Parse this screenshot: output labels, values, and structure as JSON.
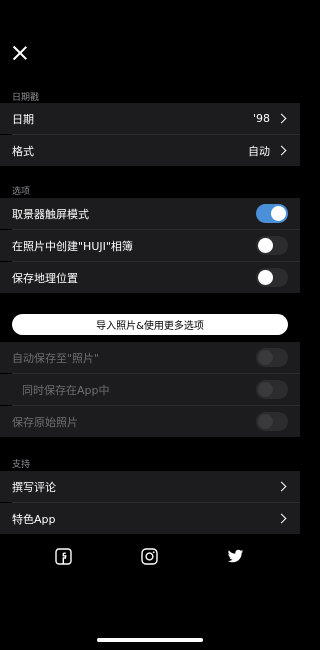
{
  "sections": {
    "date_stamp": "日期戳",
    "options": "选项",
    "support": "支持"
  },
  "date_stamp": {
    "date_label": "日期",
    "date_value": "'98",
    "format_label": "格式",
    "format_value": "自动"
  },
  "options": {
    "viewfinder_touch": {
      "label": "取景器触屏模式",
      "enabled": true
    },
    "create_album": {
      "label": "在照片中创建\"HUJI\"相簿",
      "enabled": false
    },
    "save_location": {
      "label": "保存地理位置",
      "enabled": false
    }
  },
  "import_button": "导入照片&使用更多选项",
  "locked_options": {
    "autosave": "自动保存至\"照片\"",
    "also_save_app": "同时保存在App中",
    "save_original": "保存原始照片"
  },
  "support": {
    "review": "撰写评论",
    "featured_apps": "特色App"
  },
  "social_icons": [
    "facebook-icon",
    "instagram-icon",
    "twitter-icon"
  ],
  "colors": {
    "accent": "#4a90d9",
    "row_bg": "#1c1c1e"
  }
}
